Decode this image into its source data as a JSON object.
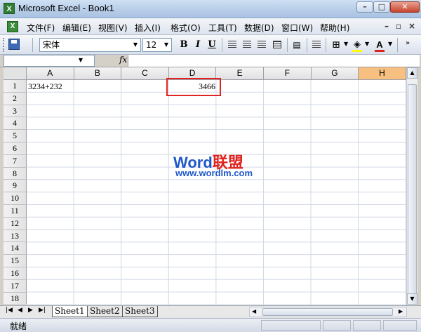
{
  "window": {
    "title": "Microsoft Excel - Book1",
    "icon": "excel-icon",
    "controls": {
      "minimize": "–",
      "restore": "□",
      "close": "✕"
    }
  },
  "menu": {
    "items": [
      "文件(F)",
      "编辑(E)",
      "视图(V)",
      "插入(I)",
      "格式(O)",
      "工具(T)",
      "数据(D)",
      "窗口(W)",
      "帮助(H)"
    ],
    "doc_controls": {
      "minimize": "–",
      "restore": "▫",
      "close": "×"
    }
  },
  "toolbar": {
    "font_name": "宋体",
    "font_size": "12",
    "bold": "B",
    "italic": "I",
    "underline": "U",
    "font_color_label": "A",
    "fill_color": "#ffff00",
    "font_color": "#e02020"
  },
  "formula_bar": {
    "name_box": "",
    "fx_label": "fx",
    "content": ""
  },
  "grid": {
    "columns": [
      "A",
      "B",
      "C",
      "D",
      "E",
      "F",
      "G",
      "H"
    ],
    "active_column": "H",
    "rows": [
      "1",
      "2",
      "3",
      "4",
      "5",
      "6",
      "7",
      "8",
      "9",
      "10",
      "11",
      "12",
      "13",
      "14",
      "15",
      "16",
      "17",
      "18"
    ],
    "cells": {
      "A1": "3234+232",
      "D1": "3466"
    },
    "highlight_color": "#e02424"
  },
  "watermark": {
    "brand_word": "Word",
    "brand_cn": "联盟",
    "url": "www.wordlm.com"
  },
  "sheet_tabs": {
    "nav": [
      "|◀",
      "◀",
      "▶",
      "▶|"
    ],
    "tabs": [
      "Sheet1",
      "Sheet2",
      "Sheet3"
    ],
    "active": "Sheet1"
  },
  "status": {
    "text": "就绪"
  }
}
